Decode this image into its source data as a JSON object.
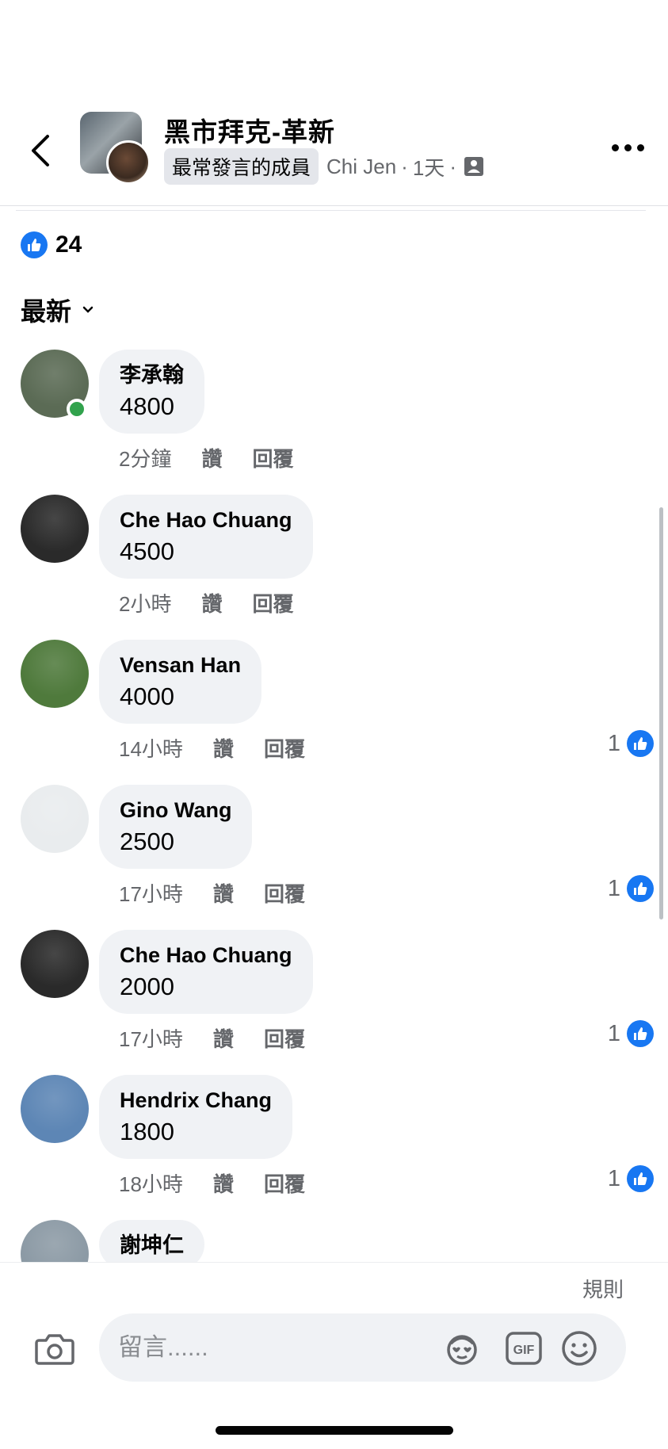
{
  "header": {
    "title": "黑市拜克-革新",
    "badge": "最常發言的成員",
    "author": "Chi Jen",
    "sep1": "·",
    "time": "1天",
    "sep2": "·"
  },
  "reactions": {
    "count": "24"
  },
  "sort": {
    "label": "最新"
  },
  "comments": [
    {
      "name": "李承翰",
      "text": "4800",
      "time": "2分鐘",
      "like": "讚",
      "reply": "回覆",
      "likes": "",
      "avatar_color": "#5b6b55",
      "online": true
    },
    {
      "name": "Che Hao Chuang",
      "text": "4500",
      "time": "2小時",
      "like": "讚",
      "reply": "回覆",
      "likes": "",
      "avatar_color": "#2a2a2a",
      "online": false
    },
    {
      "name": "Vensan Han",
      "text": "4000",
      "time": "14小時",
      "like": "讚",
      "reply": "回覆",
      "likes": "1",
      "avatar_color": "#4f7a3c",
      "online": false
    },
    {
      "name": "Gino Wang",
      "text": "2500",
      "time": "17小時",
      "like": "讚",
      "reply": "回覆",
      "likes": "1",
      "avatar_color": "#e9ecee",
      "online": false
    },
    {
      "name": "Che Hao Chuang",
      "text": "2000",
      "time": "17小時",
      "like": "讚",
      "reply": "回覆",
      "likes": "1",
      "avatar_color": "#2a2a2a",
      "online": false
    },
    {
      "name": "Hendrix Chang",
      "text": "1800",
      "time": "18小時",
      "like": "讚",
      "reply": "回覆",
      "likes": "1",
      "avatar_color": "#5d86b5",
      "online": false
    },
    {
      "name": "謝坤仁",
      "text": "",
      "time": "",
      "like": "",
      "reply": "",
      "likes": "",
      "avatar_color": "#8c9aa5",
      "online": false
    }
  ],
  "composer": {
    "rules": "規則",
    "placeholder": "留言......",
    "gif": "GIF"
  },
  "colors": {
    "accent": "#1877f2",
    "bubble": "#f0f2f5",
    "secondary_text": "#65676b",
    "online": "#31a24c"
  }
}
